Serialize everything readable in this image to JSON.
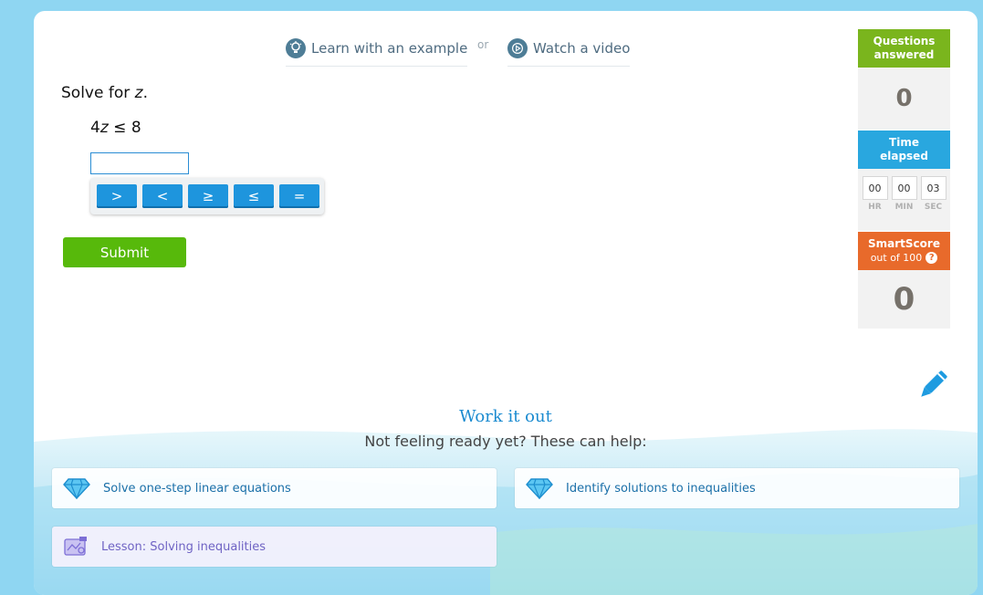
{
  "help": {
    "learn_label": "Learn with an example",
    "or_label": "or",
    "video_label": "Watch a video"
  },
  "problem": {
    "prompt_prefix": "Solve for ",
    "prompt_var": "z",
    "prompt_suffix": ".",
    "equation": {
      "coef": "4",
      "var": "z",
      "rest": " ≤ 8"
    },
    "answer_value": "",
    "symbols": [
      ">",
      "<",
      "≥",
      "≤",
      "="
    ],
    "submit_label": "Submit"
  },
  "stats": {
    "questions_label": "Questions answered",
    "questions_value": "0",
    "time_label": "Time elapsed",
    "time": {
      "hr": "00",
      "min": "00",
      "sec": "03"
    },
    "time_units": {
      "hr": "HR",
      "min": "MIN",
      "sec": "SEC"
    },
    "smartscore_label": "SmartScore",
    "smartscore_sub": "out of 100",
    "smartscore_value": "0",
    "colors": {
      "questions": "#7ab51d",
      "time": "#29a7df",
      "smartscore": "#e86a2b"
    }
  },
  "work_it_out": {
    "title": "Work it out",
    "subtitle": "Not feeling ready yet? These can help:",
    "items": [
      {
        "label": "Solve one-step linear equations",
        "icon": "diamond-icon"
      },
      {
        "label": "Identify solutions to inequalities",
        "icon": "diamond-icon"
      },
      {
        "label": "Lesson: Solving inequalities",
        "icon": "lesson-icon"
      }
    ]
  }
}
